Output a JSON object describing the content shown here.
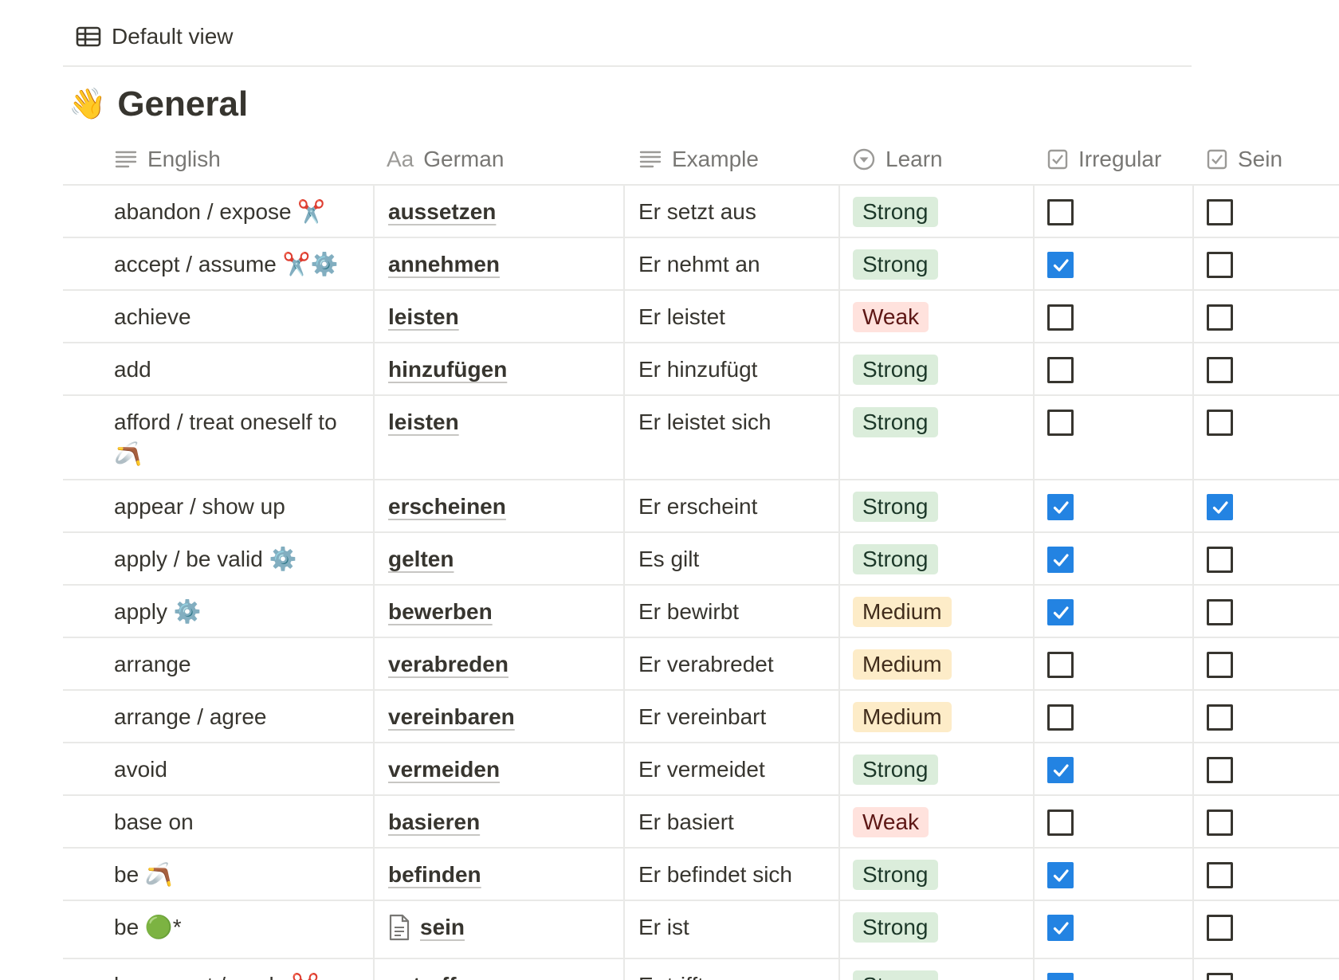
{
  "view": {
    "label": "Default view",
    "icon": "table-icon"
  },
  "group": {
    "emoji": "👋",
    "title": "General"
  },
  "columns": [
    {
      "key": "english",
      "label": "English",
      "icon": "text-lines-icon"
    },
    {
      "key": "german",
      "label": "German",
      "icon": "title-aa-icon",
      "icon_text": "Aa"
    },
    {
      "key": "example",
      "label": "Example",
      "icon": "text-lines-icon"
    },
    {
      "key": "learn",
      "label": "Learn",
      "icon": "select-circle-icon"
    },
    {
      "key": "irregular",
      "label": "Irregular",
      "icon": "checkbox-icon"
    },
    {
      "key": "sein",
      "label": "Sein",
      "icon": "checkbox-icon"
    }
  ],
  "colors": {
    "strong_bg": "#dbeddb",
    "weak_bg": "#ffe2dd",
    "medium_bg": "#fdecc8",
    "check_blue": "#2383e2"
  },
  "rows": [
    {
      "english": "abandon / expose ✂️",
      "german": "aussetzen",
      "example": "Er setzt aus",
      "learn": "Strong",
      "irregular": false,
      "sein": false
    },
    {
      "english": "accept / assume ✂️⚙️",
      "german": "annehmen",
      "example": "Er nehmt an",
      "learn": "Strong",
      "irregular": true,
      "sein": false
    },
    {
      "english": "achieve",
      "german": "leisten",
      "example": "Er leistet",
      "learn": "Weak",
      "irregular": false,
      "sein": false
    },
    {
      "english": "add",
      "german": "hinzufügen",
      "example": "Er hinzufügt",
      "learn": "Strong",
      "irregular": false,
      "sein": false
    },
    {
      "english": "afford / treat oneself to 🪃",
      "german": "leisten",
      "example": "Er leistet sich",
      "learn": "Strong",
      "irregular": false,
      "sein": false
    },
    {
      "english": "appear / show up",
      "german": "erscheinen",
      "example": "Er erscheint",
      "learn": "Strong",
      "irregular": true,
      "sein": true
    },
    {
      "english": "apply / be valid ⚙️",
      "german": "gelten",
      "example": "Es gilt",
      "learn": "Strong",
      "irregular": true,
      "sein": false
    },
    {
      "english": "apply ⚙️",
      "german": "bewerben",
      "example": "Er bewirbt",
      "learn": "Medium",
      "irregular": true,
      "sein": false
    },
    {
      "english": "arrange",
      "german": "verabreden",
      "example": "Er verabredet",
      "learn": "Medium",
      "irregular": false,
      "sein": false
    },
    {
      "english": "arrange / agree",
      "german": "vereinbaren",
      "example": "Er vereinbart",
      "learn": "Medium",
      "irregular": false,
      "sein": false
    },
    {
      "english": "avoid",
      "german": "vermeiden",
      "example": "Er vermeidet",
      "learn": "Strong",
      "irregular": true,
      "sein": false
    },
    {
      "english": "base on",
      "german": "basieren",
      "example": "Er basiert",
      "learn": "Weak",
      "irregular": false,
      "sein": false
    },
    {
      "english": "be 🪃",
      "german": "befinden",
      "example": "Er befindet sich",
      "learn": "Strong",
      "irregular": true,
      "sein": false
    },
    {
      "english": "be 🟢*",
      "german": "sein",
      "german_page_icon": true,
      "example": "Er ist",
      "learn": "Strong",
      "irregular": true,
      "sein": false
    },
    {
      "english": "be correct / apply ✂️",
      "german": "zutreffen",
      "example": "Er trifft zu",
      "learn": "Strong",
      "irregular": true,
      "sein": false
    }
  ]
}
